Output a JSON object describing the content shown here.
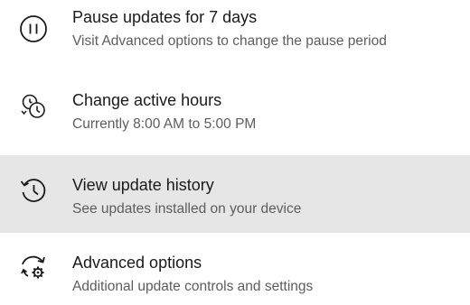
{
  "items": [
    {
      "title": "Pause updates for 7 days",
      "subtitle": "Visit Advanced options to change the pause period",
      "icon": "pause-icon",
      "selected": false
    },
    {
      "title": "Change active hours",
      "subtitle": "Currently 8:00 AM to 5:00 PM",
      "icon": "active-hours-icon",
      "selected": false
    },
    {
      "title": "View update history",
      "subtitle": "See updates installed on your device",
      "icon": "history-icon",
      "selected": true
    },
    {
      "title": "Advanced options",
      "subtitle": "Additional update controls and settings",
      "icon": "advanced-options-icon",
      "selected": false
    }
  ],
  "colors": {
    "selected_background": "#e6e6e6",
    "title_text": "#1a1a1a",
    "subtitle_text": "#5d5d5d"
  }
}
